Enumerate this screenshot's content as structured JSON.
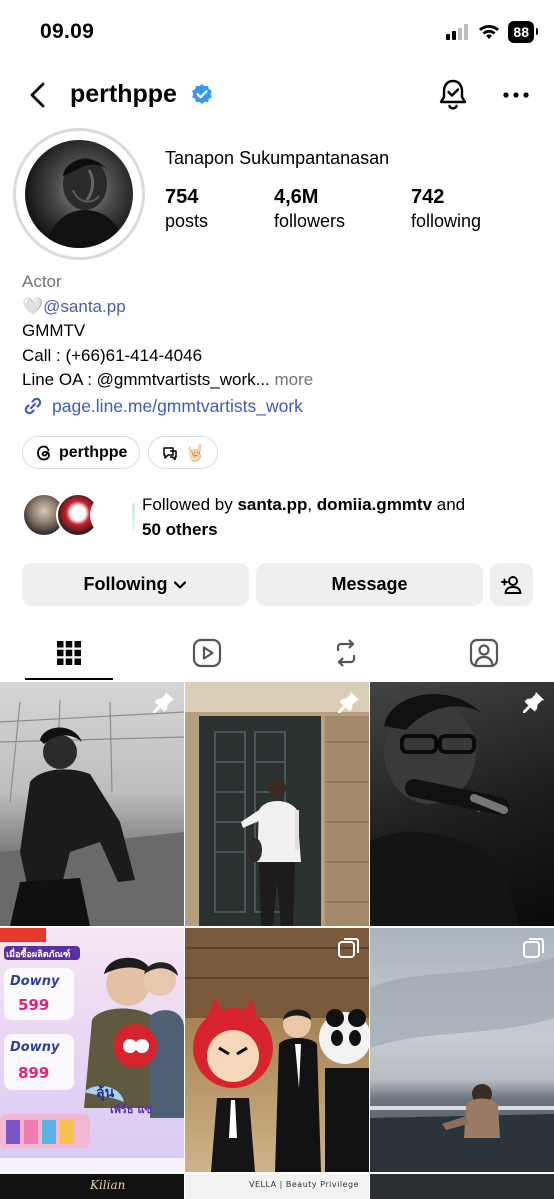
{
  "status_bar": {
    "time": "09.09",
    "battery": "88"
  },
  "header": {
    "username": "perthppe",
    "verified": true,
    "icons": [
      "back-icon",
      "verified-badge-icon",
      "notification-bell-icon",
      "more-options-icon"
    ]
  },
  "profile": {
    "full_name": "Tanapon Sukumpantanasan",
    "stats": [
      {
        "value": "754",
        "label": "posts"
      },
      {
        "value": "4,6M",
        "label": "followers"
      },
      {
        "value": "742",
        "label": "following"
      }
    ],
    "bio": {
      "category": "Actor",
      "heart": "🤍",
      "mention": "@santa.pp",
      "line2": "GMMTV",
      "line3": "Call : (+66)61-414-4046",
      "line4": "Line OA : @gmmtvartists_work...",
      "more": "more"
    },
    "link": "page.line.me/gmmtvartists_work",
    "chips": [
      {
        "label": "perthppe",
        "icon": "threads-icon"
      },
      {
        "label": "🤘🏻",
        "icon": "chat-bubble-icon"
      }
    ],
    "followed_by": {
      "prefix": "Followed by ",
      "user1": "santa.pp",
      "sep": ", ",
      "user2": "domiia.gmmtv",
      "and": " and",
      "others": "50 others"
    }
  },
  "actions": {
    "following": "Following",
    "message": "Message"
  },
  "tabs": [
    "grid-icon",
    "reels-icon",
    "reposts-icon",
    "tagged-icon"
  ],
  "grid": {
    "tiles": [
      {
        "desc": "bw-sitting",
        "badge": "pin-icon"
      },
      {
        "desc": "door-standing",
        "badge": "pin-icon"
      },
      {
        "desc": "mic-singing",
        "badge": "pin-icon"
      },
      {
        "desc": "downy-promo",
        "badge": "none"
      },
      {
        "desc": "mascot-event",
        "badge": "carousel-icon"
      },
      {
        "desc": "pool-sunset",
        "badge": "carousel-icon"
      }
    ],
    "promo_texts": {
      "top": "เมื่อซื้อผลิตภัณฑ์",
      "brand1": "Downy",
      "price1": "599",
      "brand2": "Downy",
      "price2": "899",
      "center": "ลุ้น",
      "bottom": "เพิร์ธ แซ"
    },
    "bottom_strip": {
      "left": "Kilian",
      "center": "VELLA | Beauty Privilege"
    }
  }
}
